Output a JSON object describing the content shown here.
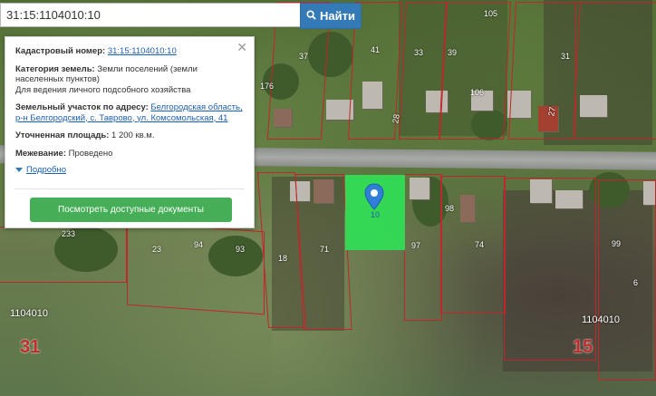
{
  "search": {
    "value": "31:15:1104010:10",
    "button_label": "Найти"
  },
  "info": {
    "cadastral_label": "Кадастровый номер:",
    "cadastral_value": "31:15:1104010:10",
    "category_label": "Категория земель:",
    "category_value": "Земли поселений (земли населенных пунктов)",
    "usage_value": "Для ведения личного подсобного хозяйства",
    "address_label": "Земельный участок по адресу:",
    "address_value": "Белгородская область, р-н Белгородский, с. Таврово, ул. Комсомольская, 41",
    "area_label": "Уточненная площадь:",
    "area_value": "1 200 кв.м.",
    "survey_label": "Межевание:",
    "survey_value": "Проведено",
    "more_label": "Подробно",
    "docs_button": "Посмотреть доступные документы"
  },
  "map": {
    "plot_numbers": [
      "105",
      "37",
      "41",
      "33",
      "39",
      "31",
      "176",
      "106",
      "28",
      "27",
      "233",
      "23",
      "94",
      "93",
      "18",
      "71",
      "10",
      "97",
      "98",
      "74",
      "99",
      "6"
    ],
    "block_labels": [
      "1104010",
      "1104010"
    ],
    "district_numbers": [
      "31",
      "15"
    ],
    "selected_parcel_color": "#2ee556",
    "marker_color": "#2f7ed8",
    "boundary_color": "#c0262a"
  }
}
